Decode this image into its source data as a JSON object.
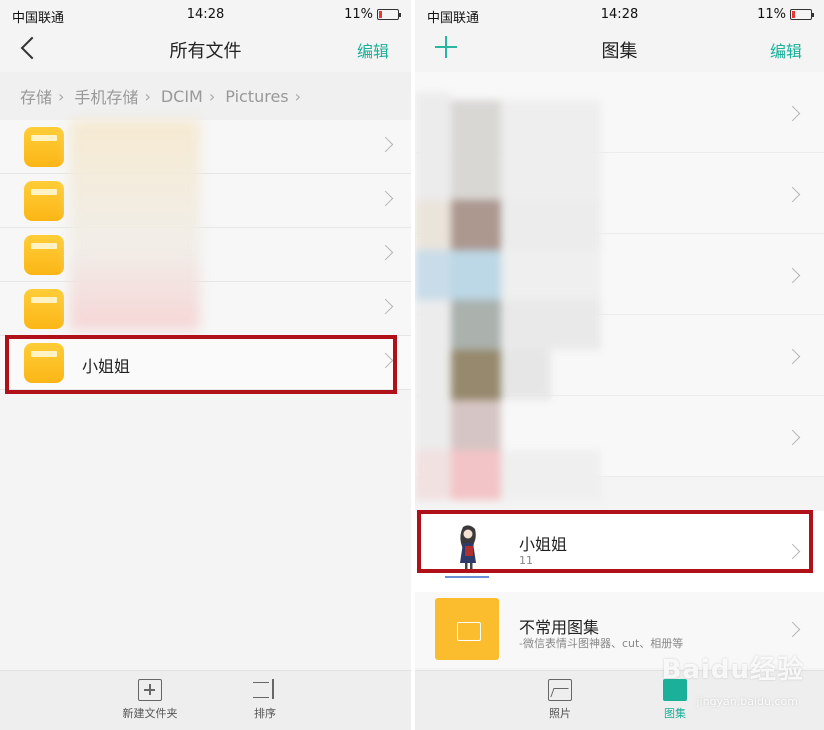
{
  "left": {
    "status": {
      "carrier": "中国联通",
      "time": "14:28",
      "battery": "11%"
    },
    "header": {
      "title": "所有文件",
      "action": "编辑"
    },
    "breadcrumb": [
      "存储",
      "手机存储",
      "DCIM",
      "Pictures"
    ],
    "folders": [
      {
        "label": ""
      },
      {
        "label": ""
      },
      {
        "label": ""
      },
      {
        "label": ""
      },
      {
        "label": "小姐姐"
      }
    ],
    "bottom": {
      "new_folder": "新建文件夹",
      "sort": "排序"
    }
  },
  "right": {
    "status": {
      "carrier": "中国联通",
      "time": "14:28",
      "battery": "11%"
    },
    "header": {
      "title": "图集",
      "action": "编辑"
    },
    "album_highlight": {
      "name": "小姐姐",
      "count": "11"
    },
    "album_rare": {
      "name": "不常用图集",
      "subtitle": "-微信表情斗图神器、cut、相册等"
    },
    "bottom": {
      "photos": "照片",
      "albums": "图集"
    }
  },
  "watermark": {
    "brand": "Baidu经验",
    "url": "jingyan.baidu.com"
  },
  "colors": {
    "accent": "#1bb09a",
    "highlight": "#b01018",
    "folder": "#fbbd2d"
  }
}
